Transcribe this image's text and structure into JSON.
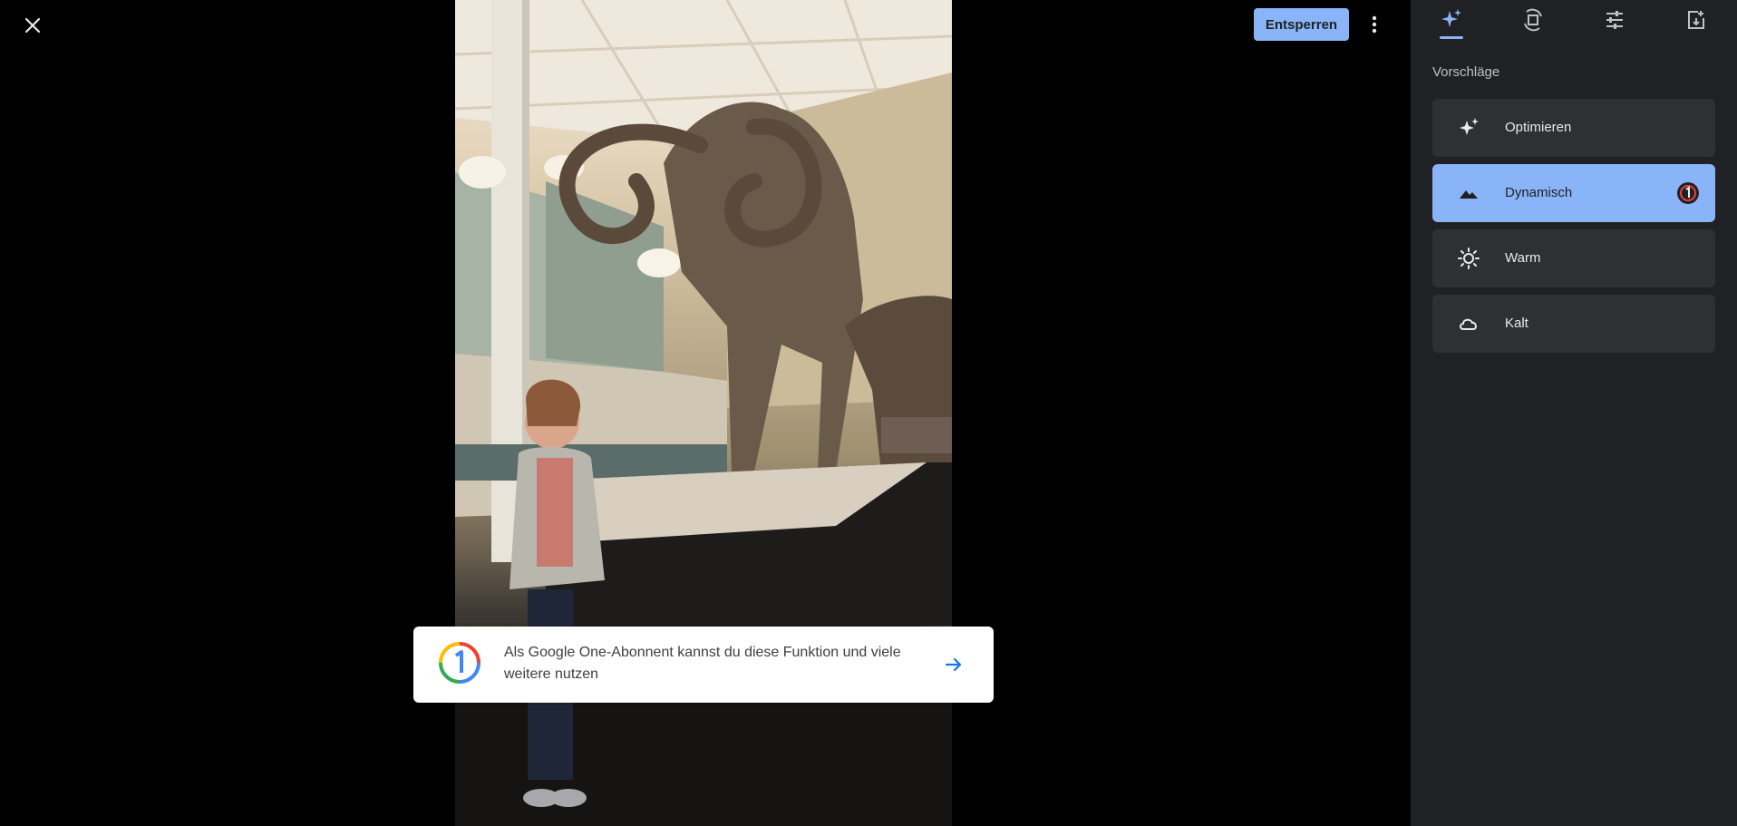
{
  "toolbar": {
    "close_icon": "close-icon",
    "unlock_label": "Entsperren",
    "more_icon": "more-vert-icon",
    "accent_color": "#8ab4f8"
  },
  "panel": {
    "tabs": [
      {
        "name": "suggestions",
        "icon": "sparkle-icon",
        "active": true
      },
      {
        "name": "crop-rotate",
        "icon": "crop-rotate-icon",
        "active": false
      },
      {
        "name": "adjust",
        "icon": "sliders-icon",
        "active": false
      },
      {
        "name": "export",
        "icon": "export-icon",
        "active": false
      }
    ],
    "section_title": "Vorschläge",
    "options": [
      {
        "label": "Optimieren",
        "icon": "sparkle-icon",
        "selected": false
      },
      {
        "label": "Dynamisch",
        "icon": "landscape-icon",
        "selected": true,
        "badge": "google-one-badge-icon"
      },
      {
        "label": "Warm",
        "icon": "sun-icon",
        "selected": false
      },
      {
        "label": "Kalt",
        "icon": "cloud-icon",
        "selected": false
      }
    ]
  },
  "promo": {
    "text": "Als Google One-Abonnent kannst du diese Funktion und viele weitere nutzen",
    "logo_icon": "google-one-logo-icon",
    "arrow_icon": "arrow-right-icon"
  },
  "photo": {
    "description_icon": "photo-museum-mammoth"
  }
}
